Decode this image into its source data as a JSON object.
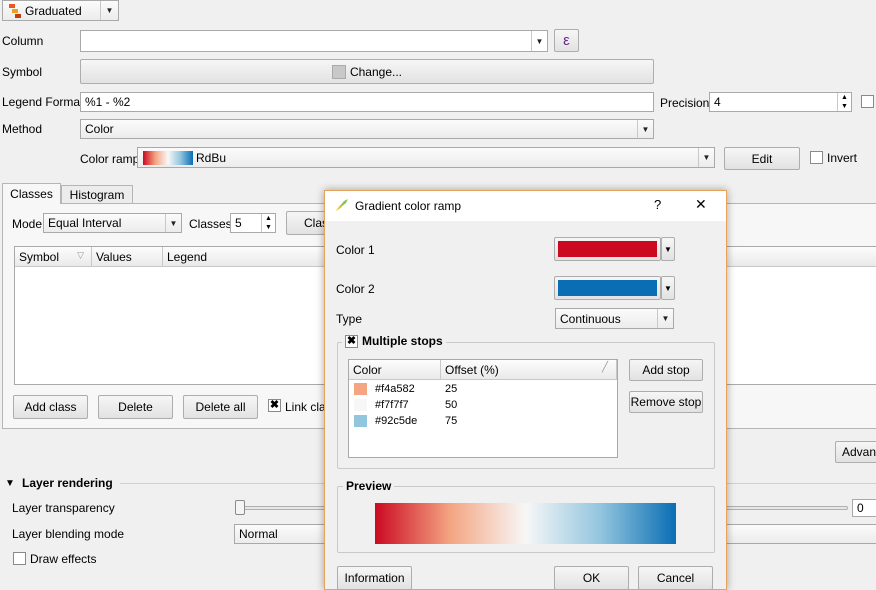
{
  "renderer": {
    "selected": "Graduated"
  },
  "form": {
    "column_label": "Column",
    "column_value": "",
    "expression_symbol": "ε",
    "symbol_label": "Symbol",
    "change_button": "Change...",
    "legend_format_label": "Legend Format",
    "legend_format_value": "%1 - %2",
    "precision_label": "Precision",
    "precision_value": "4",
    "method_label": "Method",
    "method_value": "Color",
    "color_ramp_label": "Color ramp",
    "color_ramp_value": "RdBu",
    "edit_button": "Edit",
    "invert_label": "Invert"
  },
  "tabs": {
    "classes": "Classes",
    "histogram": "Histogram"
  },
  "classes_panel": {
    "mode_label": "Mode",
    "mode_value": "Equal Interval",
    "classes_label": "Classes",
    "classes_value": "5",
    "classify_button": "Clas",
    "columns": [
      "Symbol",
      "Values",
      "Legend"
    ],
    "add_class": "Add class",
    "delete": "Delete",
    "delete_all": "Delete all",
    "link_class": "Link clas",
    "advanced": "Advan"
  },
  "layer_rendering": {
    "title": "Layer rendering",
    "transparency_label": "Layer transparency",
    "transparency_value": "0",
    "blending_label": "Layer blending mode",
    "blending_value": "Normal",
    "draw_effects_label": "Draw effects"
  },
  "dialog": {
    "title": "Gradient color ramp",
    "help": "?",
    "close": "✕",
    "color1_label": "Color 1",
    "color1": "#cb0a22",
    "color2_label": "Color 2",
    "color2": "#0a6eb4",
    "type_label": "Type",
    "type_value": "Continuous",
    "multiple_stops_label": "Multiple stops",
    "stops_columns": [
      "Color",
      "Offset (%)"
    ],
    "stops": [
      {
        "color": "#f4a582",
        "label": "#f4a582",
        "offset": "25"
      },
      {
        "color": "#f7f7f7",
        "label": "#f7f7f7",
        "offset": "50"
      },
      {
        "color": "#92c5de",
        "label": "#92c5de",
        "offset": "75"
      }
    ],
    "add_stop": "Add stop",
    "remove_stop": "Remove stop",
    "preview_label": "Preview",
    "bottom_left_button": "Information",
    "ok": "OK",
    "cancel": "Cancel"
  }
}
